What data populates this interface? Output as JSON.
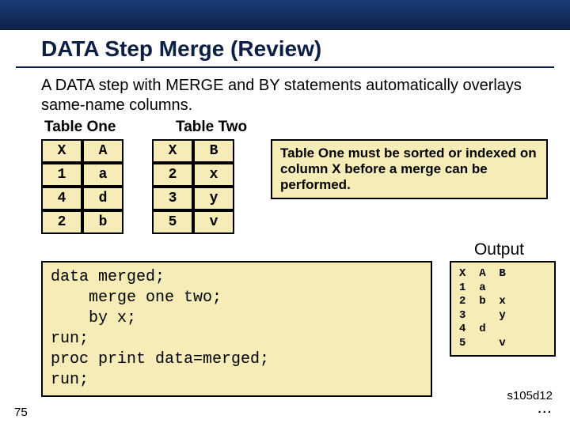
{
  "title": "DATA Step Merge (Review)",
  "paragraph": "A DATA step with MERGE and BY statements automatically overlays same-name columns.",
  "tableOne": {
    "label": "Table One",
    "headers": [
      "X",
      "A"
    ],
    "rows": [
      [
        "1",
        "a"
      ],
      [
        "4",
        "d"
      ],
      [
        "2",
        "b"
      ]
    ]
  },
  "tableTwo": {
    "label": "Table Two",
    "headers": [
      "X",
      "B"
    ],
    "rows": [
      [
        "2",
        "x"
      ],
      [
        "3",
        "y"
      ],
      [
        "5",
        "v"
      ]
    ]
  },
  "note": "Table One must be sorted or indexed on column X before a merge can be performed.",
  "outputLabel": "Output",
  "code": "data merged;\n    merge one two;\n    by x;\nrun;\nproc print data=merged;\nrun;",
  "output": "X  A  B\n1  a\n2  b  x\n3     y\n4  d\n5     v",
  "pageNumber": "75",
  "footerRef": "s105d12",
  "footerDots": "..."
}
